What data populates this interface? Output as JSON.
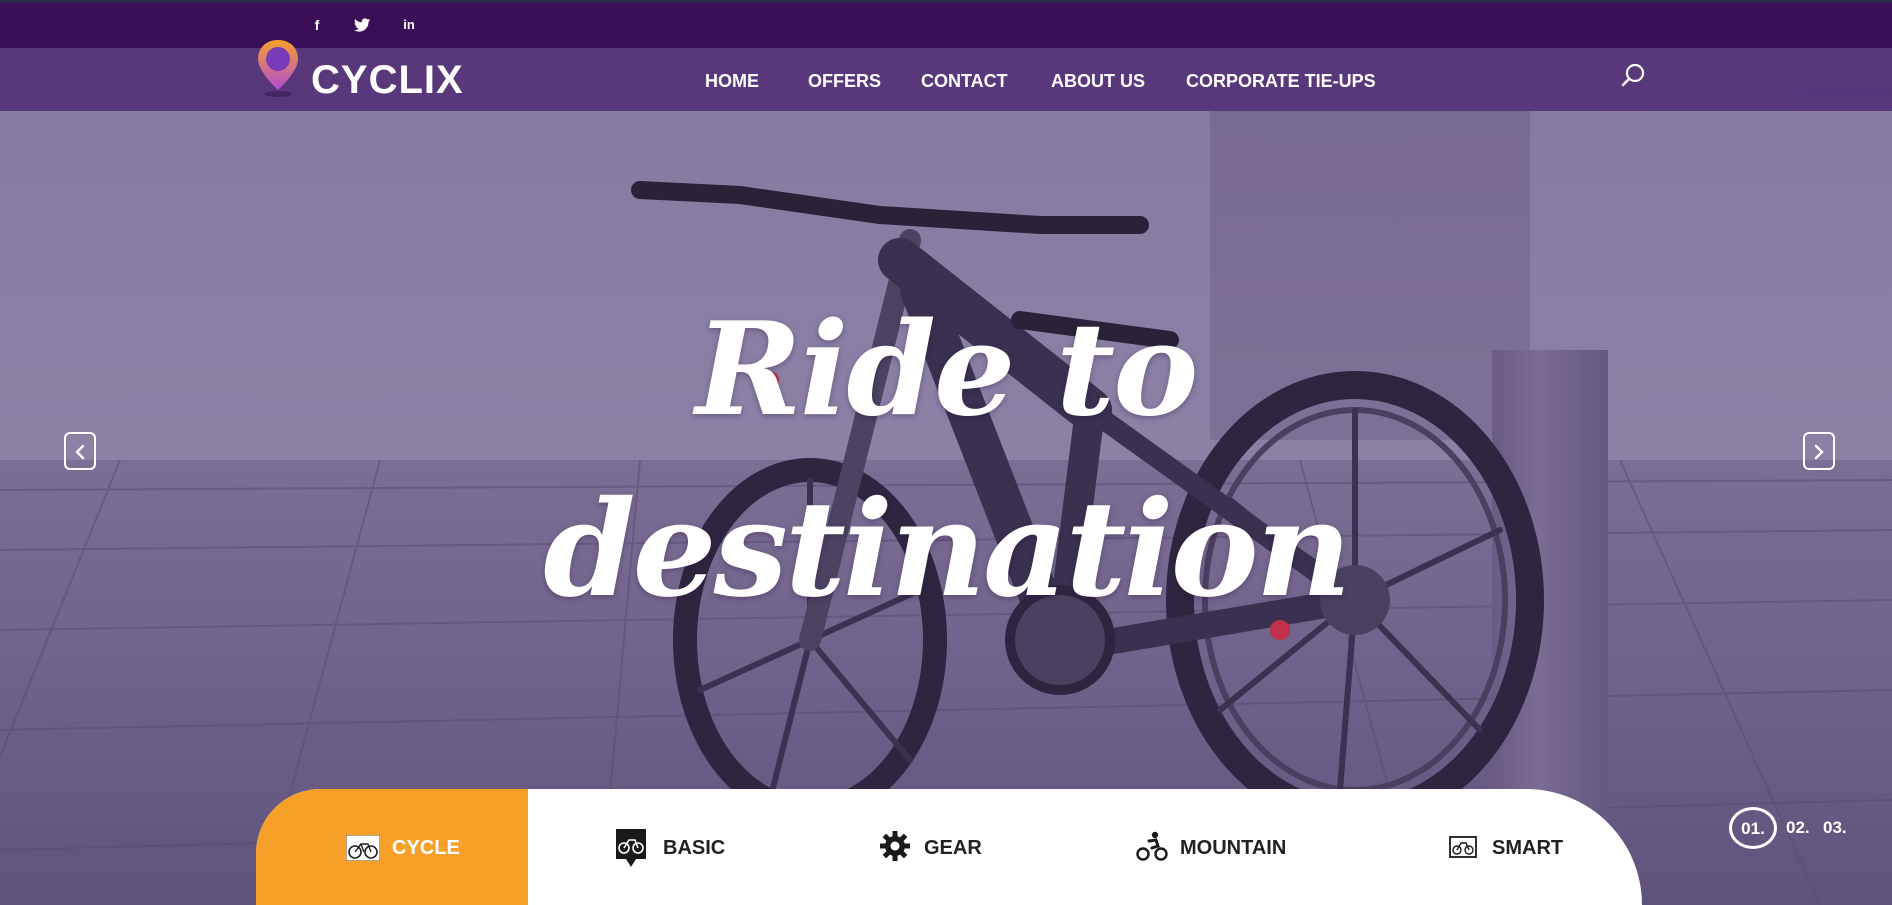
{
  "social": {
    "items": [
      {
        "icon": "facebook-icon",
        "glyph": "f"
      },
      {
        "icon": "twitter-icon",
        "glyph": "t"
      },
      {
        "icon": "linkedin-icon",
        "glyph": "in"
      }
    ]
  },
  "brand": {
    "name": "CYCLIX",
    "pin_colors": {
      "outer": "#f6a02a",
      "inner": "#7a3bb8"
    }
  },
  "nav": {
    "items": [
      {
        "label": "HOME"
      },
      {
        "label": "OFFERS"
      },
      {
        "label": "CONTACT"
      },
      {
        "label": "ABOUT US"
      },
      {
        "label": "CORPORATE TIE-UPS"
      }
    ],
    "search_icon": "search-icon"
  },
  "hero": {
    "line1": "Ride to",
    "line2": "destination"
  },
  "slider": {
    "prev_icon": "chevron-left-icon",
    "next_icon": "chevron-right-icon"
  },
  "categories": {
    "items": [
      {
        "label": "CYCLE",
        "icon": "cycle-icon",
        "active": true
      },
      {
        "label": "BASIC",
        "icon": "basic-bike-icon",
        "active": false
      },
      {
        "label": "GEAR",
        "icon": "gear-icon",
        "active": false
      },
      {
        "label": "MOUNTAIN",
        "icon": "mountain-bike-icon",
        "active": false
      },
      {
        "label": "SMART",
        "icon": "smart-bike-icon",
        "active": false
      }
    ]
  },
  "pagination": {
    "pages": [
      "01.",
      "02.",
      "03."
    ],
    "current": "01."
  },
  "colors": {
    "top_bar": "#3a0f57",
    "nav_bar": "#52306f",
    "accent": "#f6a02a",
    "text": "#ffffff"
  }
}
